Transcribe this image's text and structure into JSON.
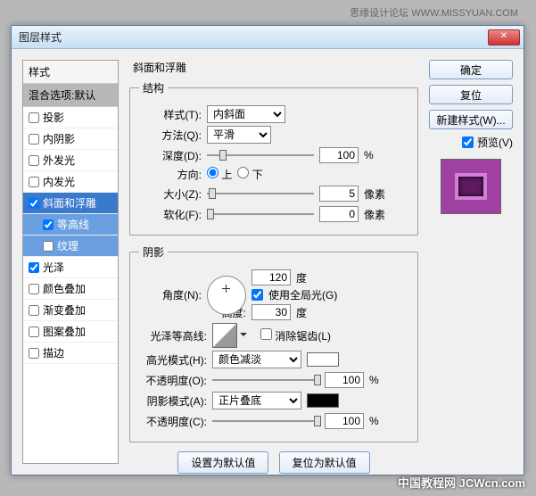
{
  "watermarks": {
    "top": "思缘设计论坛  WWW.MISSYUAN.COM",
    "bottom": "中国教程网 JCWcn.com"
  },
  "title": "图层样式",
  "sidebar": {
    "header1": "样式",
    "header2": "混合选项:默认",
    "items": [
      {
        "label": "投影",
        "checked": false
      },
      {
        "label": "内阴影",
        "checked": false
      },
      {
        "label": "外发光",
        "checked": false
      },
      {
        "label": "内发光",
        "checked": false
      },
      {
        "label": "斜面和浮雕",
        "checked": true,
        "active": true
      },
      {
        "label": "等高线",
        "checked": true,
        "sub": true,
        "subactive": true
      },
      {
        "label": "纹理",
        "checked": false,
        "sub": true,
        "subactive": true
      },
      {
        "label": "光泽",
        "checked": true
      },
      {
        "label": "颜色叠加",
        "checked": false
      },
      {
        "label": "渐变叠加",
        "checked": false
      },
      {
        "label": "图案叠加",
        "checked": false
      },
      {
        "label": "描边",
        "checked": false
      }
    ]
  },
  "panel_title": "斜面和浮雕",
  "structure": {
    "legend": "结构",
    "style_label": "样式(T):",
    "style_value": "内斜面",
    "technique_label": "方法(Q):",
    "technique_value": "平滑",
    "depth_label": "深度(D):",
    "depth_value": "100",
    "depth_unit": "%",
    "direction_label": "方向:",
    "up_label": "上",
    "down_label": "下",
    "size_label": "大小(Z):",
    "size_value": "5",
    "size_unit": "像素",
    "soften_label": "软化(F):",
    "soften_value": "0",
    "soften_unit": "像素"
  },
  "shading": {
    "legend": "阴影",
    "angle_label": "角度(N):",
    "angle_value": "120",
    "angle_unit": "度",
    "global_label": "使用全局光(G)",
    "altitude_label": "高度:",
    "altitude_value": "30",
    "altitude_unit": "度",
    "contour_label": "光泽等高线:",
    "antialias_label": "消除锯齿(L)",
    "highlight_mode_label": "高光模式(H):",
    "highlight_mode_value": "颜色减淡",
    "highlight_color": "#ffffff",
    "highlight_opacity_label": "不透明度(O):",
    "highlight_opacity_value": "100",
    "highlight_opacity_unit": "%",
    "shadow_mode_label": "阴影模式(A):",
    "shadow_mode_value": "正片叠底",
    "shadow_color": "#000000",
    "shadow_opacity_label": "不透明度(C):",
    "shadow_opacity_value": "100",
    "shadow_opacity_unit": "%"
  },
  "bottom": {
    "make_default": "设置为默认值",
    "reset_default": "复位为默认值"
  },
  "buttons": {
    "ok": "确定",
    "cancel": "复位",
    "new_style": "新建样式(W)...",
    "preview": "预览(V)"
  }
}
